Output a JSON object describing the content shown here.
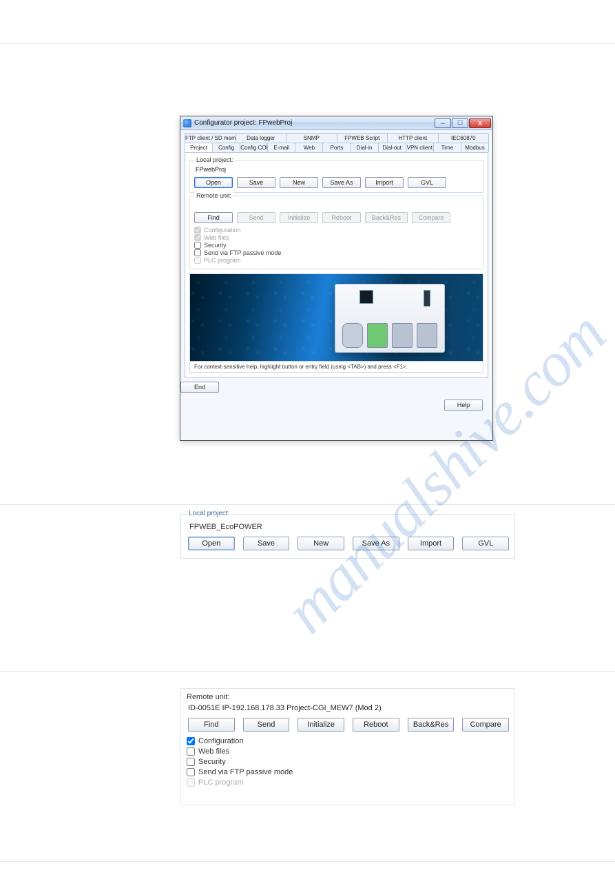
{
  "watermark": "manualshive.com",
  "window": {
    "title": "Configurator project: FPwebProj",
    "controls": {
      "min": "─",
      "max": "☐",
      "close": "X"
    },
    "tabs_row1": [
      "FTP client / SD memory card",
      "Data logger",
      "SNMP",
      "FPWEB Script",
      "HTTP client",
      "IEC60870"
    ],
    "tabs_row2": [
      "Project",
      "Config",
      "Config COM",
      "E-mail",
      "Web",
      "Ports",
      "Dial-in",
      "Dial-out",
      "VPN client",
      "Time",
      "Modbus"
    ],
    "local": {
      "legend": "Local project:",
      "name": "FPwebProj",
      "buttons": [
        "Open",
        "Save",
        "New",
        "Save As",
        "Import",
        "GVL"
      ]
    },
    "remote": {
      "legend": "Remote unit:",
      "ip": "",
      "buttons": [
        "Find",
        "Send",
        "Initialize",
        "Reboot",
        "Back&Res",
        "Compare"
      ],
      "checks": [
        {
          "label": "Configuration",
          "checked": true,
          "disabled": true
        },
        {
          "label": "Web files",
          "checked": true,
          "disabled": true
        },
        {
          "label": "Security",
          "checked": false,
          "disabled": false
        },
        {
          "label": "Send via FTP passive mode",
          "checked": false,
          "disabled": false
        },
        {
          "label": "PLC program",
          "checked": false,
          "disabled": true
        }
      ]
    },
    "help_strip": "For context-sensitive help, highlight button or entry field (using <TAB>) and press <F1>.",
    "footer": {
      "end": "End",
      "help": "Help"
    }
  },
  "detail_local": {
    "legend": "Local project:",
    "name": "FPWEB_EcoPOWER",
    "buttons": [
      "Open",
      "Save",
      "New",
      "Save As",
      "Import",
      "GVL"
    ]
  },
  "detail_remote": {
    "legend": "Remote unit:",
    "ip": "ID-0051E  IP-192.168.178.33  Project-CGI_MEW7   (Mod 2)",
    "buttons": [
      "Find",
      "Send",
      "Initialize",
      "Reboot",
      "Back&Res",
      "Compare"
    ],
    "checks": [
      {
        "label": "Configuration",
        "checked": true,
        "disabled": false
      },
      {
        "label": "Web files",
        "checked": false,
        "disabled": false
      },
      {
        "label": "Security",
        "checked": false,
        "disabled": false
      },
      {
        "label": "Send via FTP passive mode",
        "checked": false,
        "disabled": false
      },
      {
        "label": "PLC program",
        "checked": false,
        "disabled": true
      }
    ]
  }
}
